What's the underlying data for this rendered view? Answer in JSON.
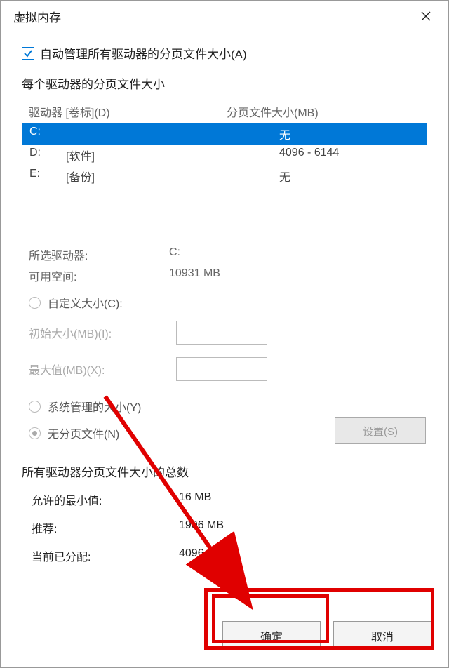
{
  "window": {
    "title": "虚拟内存"
  },
  "auto_manage": {
    "label": "自动管理所有驱动器的分页文件大小(A)",
    "checked": true
  },
  "drive_section": {
    "title": "每个驱动器的分页文件大小",
    "header_drive": "驱动器 [卷标](D)",
    "header_page": "分页文件大小(MB)",
    "rows": [
      {
        "letter": "C:",
        "label": "",
        "page": "无",
        "selected": true
      },
      {
        "letter": "D:",
        "label": "[软件]",
        "page": "4096 - 6144",
        "selected": false
      },
      {
        "letter": "E:",
        "label": "[备份]",
        "page": "无",
        "selected": false
      }
    ]
  },
  "selected": {
    "drive_label": "所选驱动器:",
    "drive_value": "C:",
    "free_label": "可用空间:",
    "free_value": "10931 MB"
  },
  "radios": {
    "custom": "自定义大小(C):",
    "initial": "初始大小(MB)(I):",
    "max": "最大值(MB)(X):",
    "system": "系统管理的大小(Y)",
    "none": "无分页文件(N)"
  },
  "set_button": "设置(S)",
  "totals": {
    "title": "所有驱动器分页文件大小的总数",
    "min_label": "允许的最小值:",
    "min_value": "16 MB",
    "rec_label": "推荐:",
    "rec_value": "1906 MB",
    "cur_label": "当前已分配:",
    "cur_value": "4096 MB"
  },
  "footer": {
    "ok": "确定",
    "cancel": "取消"
  }
}
